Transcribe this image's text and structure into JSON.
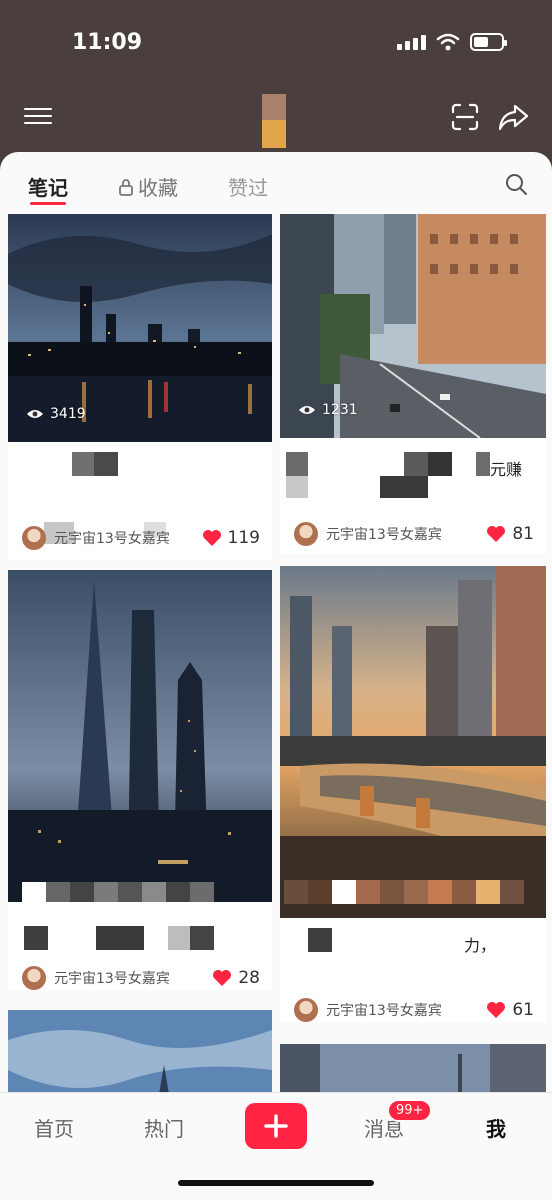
{
  "status_bar": {
    "time": "11:09",
    "battery_level": 0.55
  },
  "header": {
    "icons": [
      "menu-icon",
      "scan-icon",
      "share-icon"
    ]
  },
  "tabs": [
    {
      "label": "笔记",
      "active": true
    },
    {
      "label": "收藏",
      "locked": true
    },
    {
      "label": "赞过"
    }
  ],
  "cards": [
    {
      "views": "3419",
      "author": "元宇宙13号女嘉宾",
      "likes": "119"
    },
    {
      "views": "1231",
      "author": "元宇宙13号女嘉宾",
      "likes": "81",
      "title_fragment": "元赚"
    },
    {
      "author": "元宇宙13号女嘉宾",
      "likes": "28"
    },
    {
      "author": "元宇宙13号女嘉宾",
      "likes": "61",
      "title_fragment": "力，"
    }
  ],
  "bottom_nav": {
    "items": [
      "首页",
      "热门",
      "消息",
      "我"
    ],
    "badge": "99+"
  },
  "colors": {
    "accent": "#ff2442",
    "header_bg": "#4a3f3c"
  }
}
